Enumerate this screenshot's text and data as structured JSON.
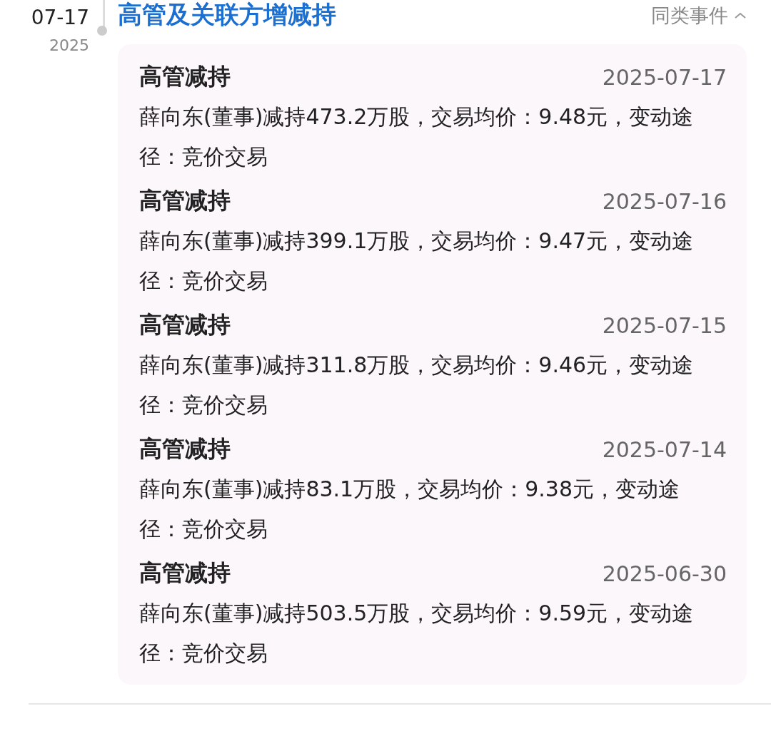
{
  "event": {
    "date": "07-17",
    "year": "2025",
    "title": "高管及关联方增减持",
    "similar_link": "同类事件",
    "expanded": true
  },
  "records": [
    {
      "type": "高管减持",
      "date": "2025-07-17",
      "detail": "薛向东(董事)减持473.2万股，交易均价：9.48元，变动途径：竞价交易"
    },
    {
      "type": "高管减持",
      "date": "2025-07-16",
      "detail": "薛向东(董事)减持399.1万股，交易均价：9.47元，变动途径：竞价交易"
    },
    {
      "type": "高管减持",
      "date": "2025-07-15",
      "detail": "薛向东(董事)减持311.8万股，交易均价：9.46元，变动途径：竞价交易"
    },
    {
      "type": "高管减持",
      "date": "2025-07-14",
      "detail": "薛向东(董事)减持83.1万股，交易均价：9.38元，变动途径：竞价交易"
    },
    {
      "type": "高管减持",
      "date": "2025-06-30",
      "detail": "薛向东(董事)减持503.5万股，交易均价：9.59元，变动途径：竞价交易"
    }
  ]
}
